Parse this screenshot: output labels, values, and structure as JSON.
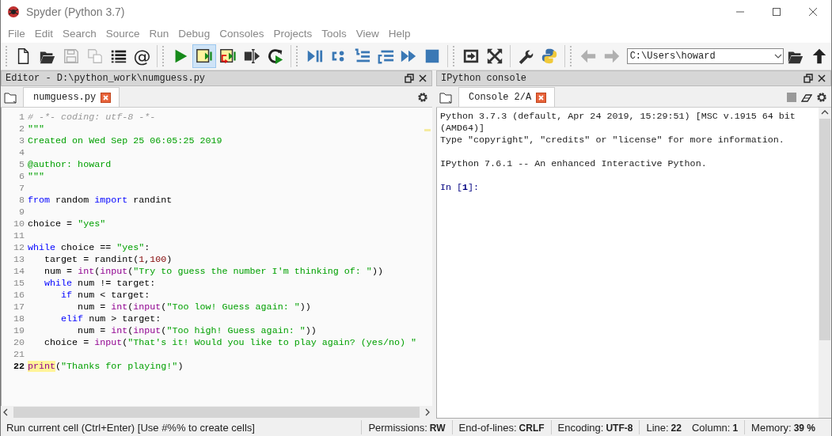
{
  "window": {
    "title": "Spyder (Python 3.7)"
  },
  "menu": [
    "File",
    "Edit",
    "Search",
    "Source",
    "Run",
    "Debug",
    "Consoles",
    "Projects",
    "Tools",
    "View",
    "Help"
  ],
  "toolbar": {
    "groups": [
      {
        "buttons": [
          {
            "kind": "new-file",
            "disabled": false,
            "hovered": false
          },
          {
            "kind": "open",
            "disabled": false,
            "hovered": false
          },
          {
            "kind": "save",
            "disabled": true,
            "hovered": false
          },
          {
            "kind": "save-all",
            "disabled": true,
            "hovered": false
          },
          {
            "kind": "outline",
            "disabled": false,
            "hovered": false
          },
          {
            "kind": "symbol",
            "text": "@",
            "disabled": false,
            "hovered": false
          }
        ]
      },
      {
        "buttons": [
          {
            "kind": "run",
            "disabled": false,
            "hovered": false
          },
          {
            "kind": "run-cell",
            "disabled": false,
            "hovered": true
          },
          {
            "kind": "run-cell-advance",
            "disabled": false,
            "hovered": false
          },
          {
            "kind": "run-selection",
            "disabled": false,
            "hovered": false
          },
          {
            "kind": "rerun",
            "disabled": false,
            "hovered": false
          }
        ]
      },
      {
        "buttons": [
          {
            "kind": "debug",
            "disabled": false,
            "hovered": false
          },
          {
            "kind": "step",
            "disabled": false,
            "hovered": false
          },
          {
            "kind": "step-into",
            "disabled": false,
            "hovered": false
          },
          {
            "kind": "step-return",
            "disabled": false,
            "hovered": false
          },
          {
            "kind": "continue",
            "disabled": false,
            "hovered": false
          },
          {
            "kind": "stop",
            "disabled": false,
            "hovered": false
          }
        ]
      },
      {
        "buttons": [
          {
            "kind": "maximize",
            "disabled": false,
            "hovered": false
          },
          {
            "kind": "fullscreen",
            "disabled": false,
            "hovered": false
          }
        ]
      },
      {
        "buttons": [
          {
            "kind": "preferences",
            "disabled": false,
            "hovered": false
          },
          {
            "kind": "python-path",
            "disabled": false,
            "hovered": false
          }
        ]
      },
      {
        "buttons": [
          {
            "kind": "back",
            "disabled": true,
            "hovered": false
          },
          {
            "kind": "forward",
            "disabled": true,
            "hovered": false
          }
        ]
      }
    ],
    "working_directory": "C:\\Users\\howard"
  },
  "editor": {
    "title": "Editor - D:\\python_work\\numguess.py",
    "tabs": [
      {
        "label": "numguess.py",
        "selected": true
      }
    ],
    "lines": [
      {
        "number": "1",
        "current": false,
        "tokens": [
          {
            "kind": "comment",
            "text": "# -*- coding: utf-8 -*-"
          }
        ]
      },
      {
        "number": "2",
        "current": false,
        "tokens": [
          {
            "kind": "string",
            "text": "\"\"\""
          }
        ]
      },
      {
        "number": "3",
        "current": false,
        "tokens": [
          {
            "kind": "string",
            "text": "Created on Wed Sep 25 06:05:25 2019"
          }
        ]
      },
      {
        "number": "4",
        "current": false
      },
      {
        "number": "5",
        "current": false,
        "tokens": [
          {
            "kind": "string",
            "text": "@author: howard"
          }
        ]
      },
      {
        "number": "6",
        "current": false,
        "tokens": [
          {
            "kind": "string",
            "text": "\"\"\""
          }
        ]
      },
      {
        "number": "7",
        "current": false
      },
      {
        "number": "8",
        "current": false,
        "tokens": [
          {
            "kind": "keyword",
            "text": "from"
          },
          {
            "kind": "plain",
            "text": " random "
          },
          {
            "kind": "keyword",
            "text": "import"
          },
          {
            "kind": "plain",
            "text": " randint"
          }
        ]
      },
      {
        "number": "9",
        "current": false
      },
      {
        "number": "10",
        "current": false,
        "tokens": [
          {
            "kind": "plain",
            "text": "choice = "
          },
          {
            "kind": "string",
            "text": "\"yes\""
          }
        ]
      },
      {
        "number": "11",
        "current": false
      },
      {
        "number": "12",
        "current": false,
        "tokens": [
          {
            "kind": "keyword",
            "text": "while"
          },
          {
            "kind": "plain",
            "text": " choice == "
          },
          {
            "kind": "string",
            "text": "\"yes\""
          },
          {
            "kind": "plain",
            "text": ":"
          }
        ]
      },
      {
        "number": "13",
        "current": false,
        "tokens": [
          {
            "kind": "plain",
            "text": "   target = randint("
          },
          {
            "kind": "number",
            "text": "1"
          },
          {
            "kind": "plain",
            "text": ","
          },
          {
            "kind": "number",
            "text": "100"
          },
          {
            "kind": "plain",
            "text": ")"
          }
        ]
      },
      {
        "number": "14",
        "current": false,
        "tokens": [
          {
            "kind": "plain",
            "text": "   num = "
          },
          {
            "kind": "builtin",
            "text": "int"
          },
          {
            "kind": "plain",
            "text": "("
          },
          {
            "kind": "builtin",
            "text": "input"
          },
          {
            "kind": "plain",
            "text": "("
          },
          {
            "kind": "string",
            "text": "\"Try to guess the number I'm thinking of: \""
          },
          {
            "kind": "plain",
            "text": "))"
          }
        ]
      },
      {
        "number": "15",
        "current": false,
        "tokens": [
          {
            "kind": "keyword",
            "text": "   while"
          },
          {
            "kind": "plain",
            "text": " num != target:"
          }
        ]
      },
      {
        "number": "16",
        "current": false,
        "tokens": [
          {
            "kind": "keyword",
            "text": "      if"
          },
          {
            "kind": "plain",
            "text": " num < target:"
          }
        ]
      },
      {
        "number": "17",
        "current": false,
        "tokens": [
          {
            "kind": "plain",
            "text": "         num = "
          },
          {
            "kind": "builtin",
            "text": "int"
          },
          {
            "kind": "plain",
            "text": "("
          },
          {
            "kind": "builtin",
            "text": "input"
          },
          {
            "kind": "plain",
            "text": "("
          },
          {
            "kind": "string",
            "text": "\"Too low! Guess again: \""
          },
          {
            "kind": "plain",
            "text": "))"
          }
        ]
      },
      {
        "number": "18",
        "current": false,
        "tokens": [
          {
            "kind": "keyword",
            "text": "      elif"
          },
          {
            "kind": "plain",
            "text": " num > target:"
          }
        ]
      },
      {
        "number": "19",
        "current": false,
        "tokens": [
          {
            "kind": "plain",
            "text": "         num = "
          },
          {
            "kind": "builtin",
            "text": "int"
          },
          {
            "kind": "plain",
            "text": "("
          },
          {
            "kind": "builtin",
            "text": "input"
          },
          {
            "kind": "plain",
            "text": "("
          },
          {
            "kind": "string",
            "text": "\"Too high! Guess again: \""
          },
          {
            "kind": "plain",
            "text": "))"
          }
        ]
      },
      {
        "number": "20",
        "current": false,
        "tokens": [
          {
            "kind": "plain",
            "text": "   choice = "
          },
          {
            "kind": "builtin",
            "text": "input"
          },
          {
            "kind": "plain",
            "text": "("
          },
          {
            "kind": "string",
            "text": "\"That's it! Would you like to play again? (yes/no) \""
          }
        ]
      },
      {
        "number": "21",
        "current": false
      },
      {
        "number": "22",
        "current": true,
        "tokens": [
          {
            "kind": "builtin_match",
            "text": "print"
          },
          {
            "kind": "plain",
            "text": "("
          },
          {
            "kind": "string",
            "text": "\"Thanks for playing!\""
          },
          {
            "kind": "plain",
            "text": ")"
          }
        ]
      }
    ]
  },
  "console": {
    "title": "IPython console",
    "tabs": [
      {
        "label": "Console 2/A",
        "selected": true
      }
    ],
    "lines": [
      {
        "kind": "output",
        "text": "Python 3.7.3 (default, Apr 24 2019, 15:29:51) [MSC v.1915 64 bit (AMD64)]"
      },
      {
        "kind": "output",
        "text": "Type \"copyright\", \"credits\" or \"license\" for more information."
      },
      {
        "kind": "blank"
      },
      {
        "kind": "output",
        "text": "IPython 7.6.1 -- An enhanced Interactive Python."
      },
      {
        "kind": "blank"
      },
      {
        "kind": "prompt",
        "text": "In [",
        "number": "1",
        "suffix": "]:"
      }
    ]
  },
  "status_bar": {
    "message": "Run current cell (Ctrl+Enter) [Use #%% to create cells]",
    "segments": [
      {
        "fields": [
          {
            "label": "Permissions:",
            "value": "RW"
          }
        ]
      },
      {
        "fields": [
          {
            "label": "End-of-lines:",
            "value": "CRLF"
          }
        ]
      },
      {
        "fields": [
          {
            "label": "Encoding:",
            "value": "UTF-8"
          }
        ]
      },
      {
        "fields": [
          {
            "label": "Line:",
            "value": "22"
          },
          {
            "label": "Column:",
            "value": "1"
          }
        ]
      },
      {
        "fields": [
          {
            "label": "Memory:",
            "value": "39 %"
          }
        ]
      }
    ]
  }
}
